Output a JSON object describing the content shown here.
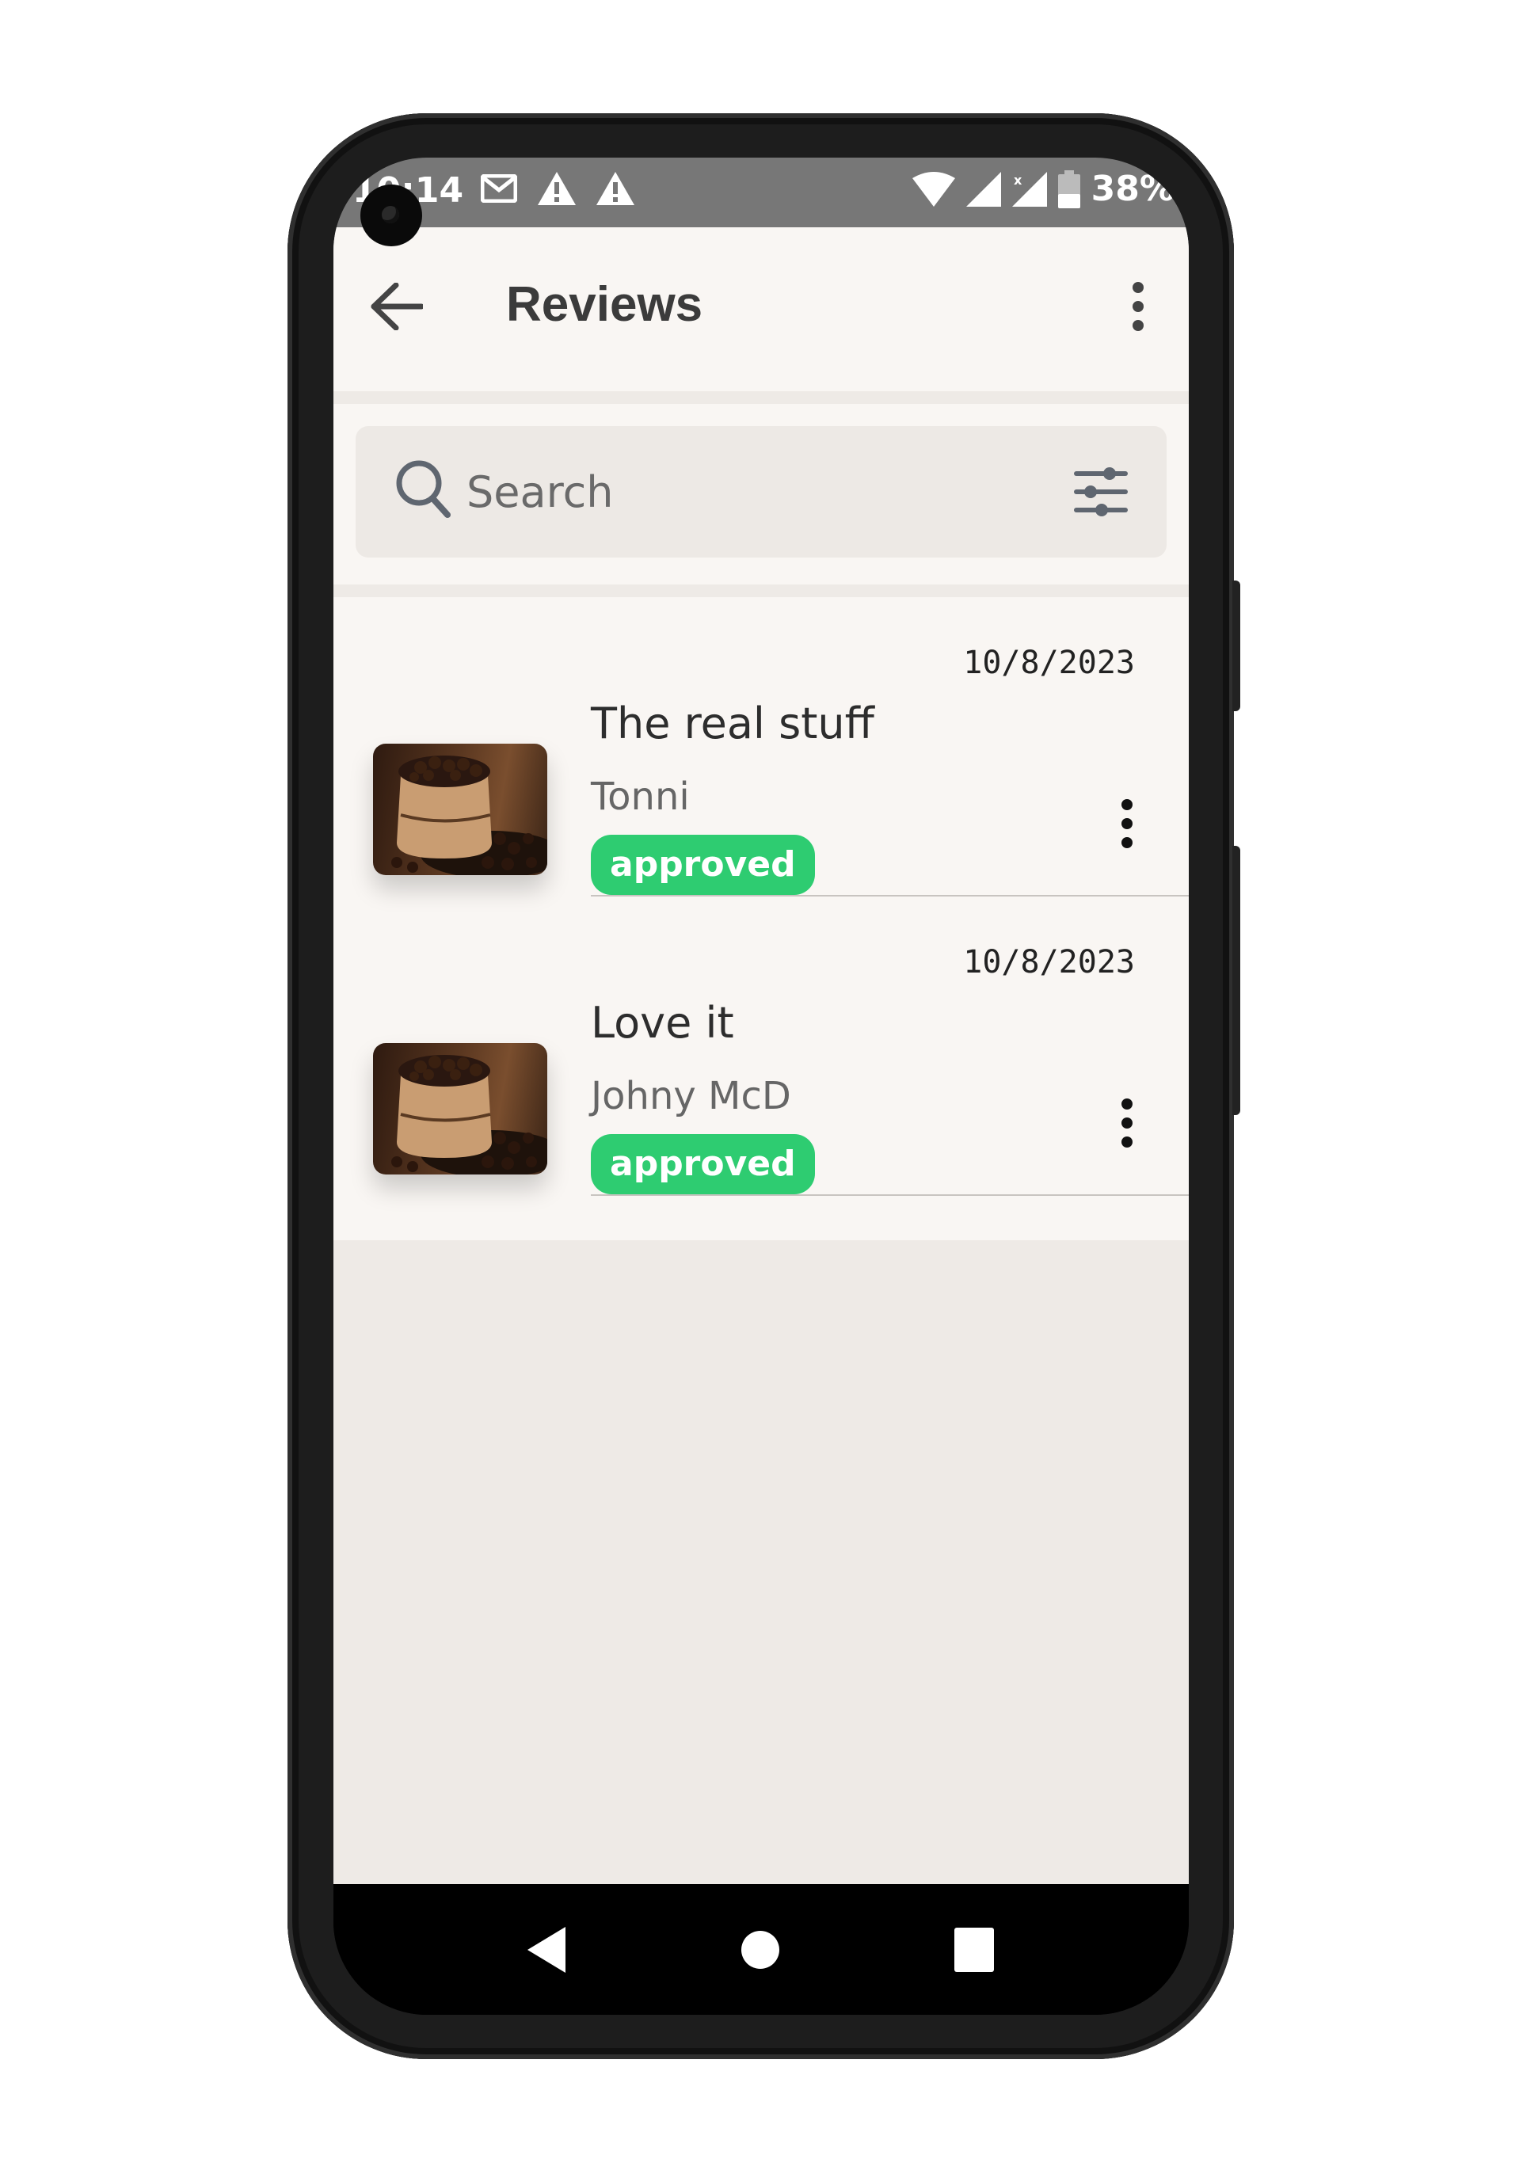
{
  "status_bar": {
    "time": "10:14",
    "battery": "38%",
    "left_icons": [
      "gmail-icon",
      "warning-icon",
      "warning-icon"
    ],
    "right_icons": [
      "wifi-icon",
      "signal-icon",
      "signal-x-icon",
      "battery-icon"
    ]
  },
  "app_bar": {
    "title": "Reviews",
    "back_icon": "arrow-left-icon",
    "menu_icon": "more-vert-icon"
  },
  "search": {
    "placeholder": "Search",
    "value": "",
    "icon": "search-icon",
    "filter_icon": "tune-icon"
  },
  "reviews": [
    {
      "date": "10/8/2023",
      "title": "The real stuff",
      "author": "Tonni",
      "status": "approved",
      "thumbnail": "coffee-beans-sack"
    },
    {
      "date": "10/8/2023",
      "title": "Love it",
      "author": "Johny McD",
      "status": "approved",
      "thumbnail": "coffee-beans-sack"
    }
  ],
  "colors": {
    "approved_badge": "#2ecc71",
    "background": "#eeeae6",
    "surface": "#f9f6f3",
    "status_bar": "#777777"
  },
  "nav_bar": {
    "buttons": [
      "back-triangle-icon",
      "home-circle-icon",
      "recents-square-icon"
    ]
  }
}
